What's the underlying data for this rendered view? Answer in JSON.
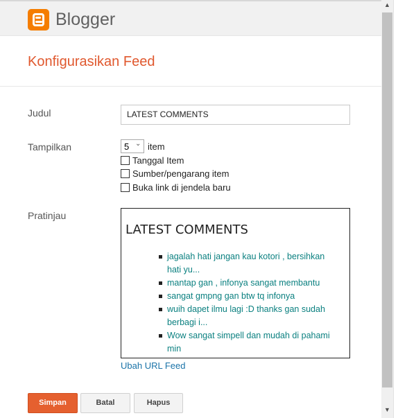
{
  "header": {
    "brand": "Blogger",
    "logo_icon": "blogger-logo-icon",
    "accent": "#f57d00"
  },
  "page": {
    "title": "Konfigurasikan Feed",
    "title_color": "#e0582e"
  },
  "form": {
    "title_label": "Judul",
    "title_value": "LATEST COMMENTS",
    "show_label": "Tampilkan",
    "show_count": "5",
    "show_suffix": "item",
    "checkboxes": [
      {
        "label": "Tanggal Item",
        "checked": false
      },
      {
        "label": "Sumber/pengarang item",
        "checked": false
      },
      {
        "label": "Buka link di jendela baru",
        "checked": false
      }
    ],
    "preview_label": "Pratinjau",
    "change_url_link": "Ubah URL Feed"
  },
  "preview": {
    "heading": "LATEST COMMENTS",
    "items": [
      {
        "line1": "jagalah hati jangan kau kotori , bersihkan",
        "line2": "hati yu..."
      },
      {
        "line1": "mantap gan , infonya sangat membantu",
        "line2": ""
      },
      {
        "line1": "sangat gmpng gan btw tq infonya",
        "line2": ""
      },
      {
        "line1": "wuih dapet ilmu lagi :D thanks gan sudah",
        "line2": "berbagi i..."
      },
      {
        "line1": "Wow sangat simpell dan mudah di pahami",
        "line2": "min"
      }
    ],
    "link_color": "#0b8080"
  },
  "buttons": {
    "save": "Simpan",
    "cancel": "Batal",
    "delete": "Hapus",
    "save_color": "#e5602f"
  }
}
